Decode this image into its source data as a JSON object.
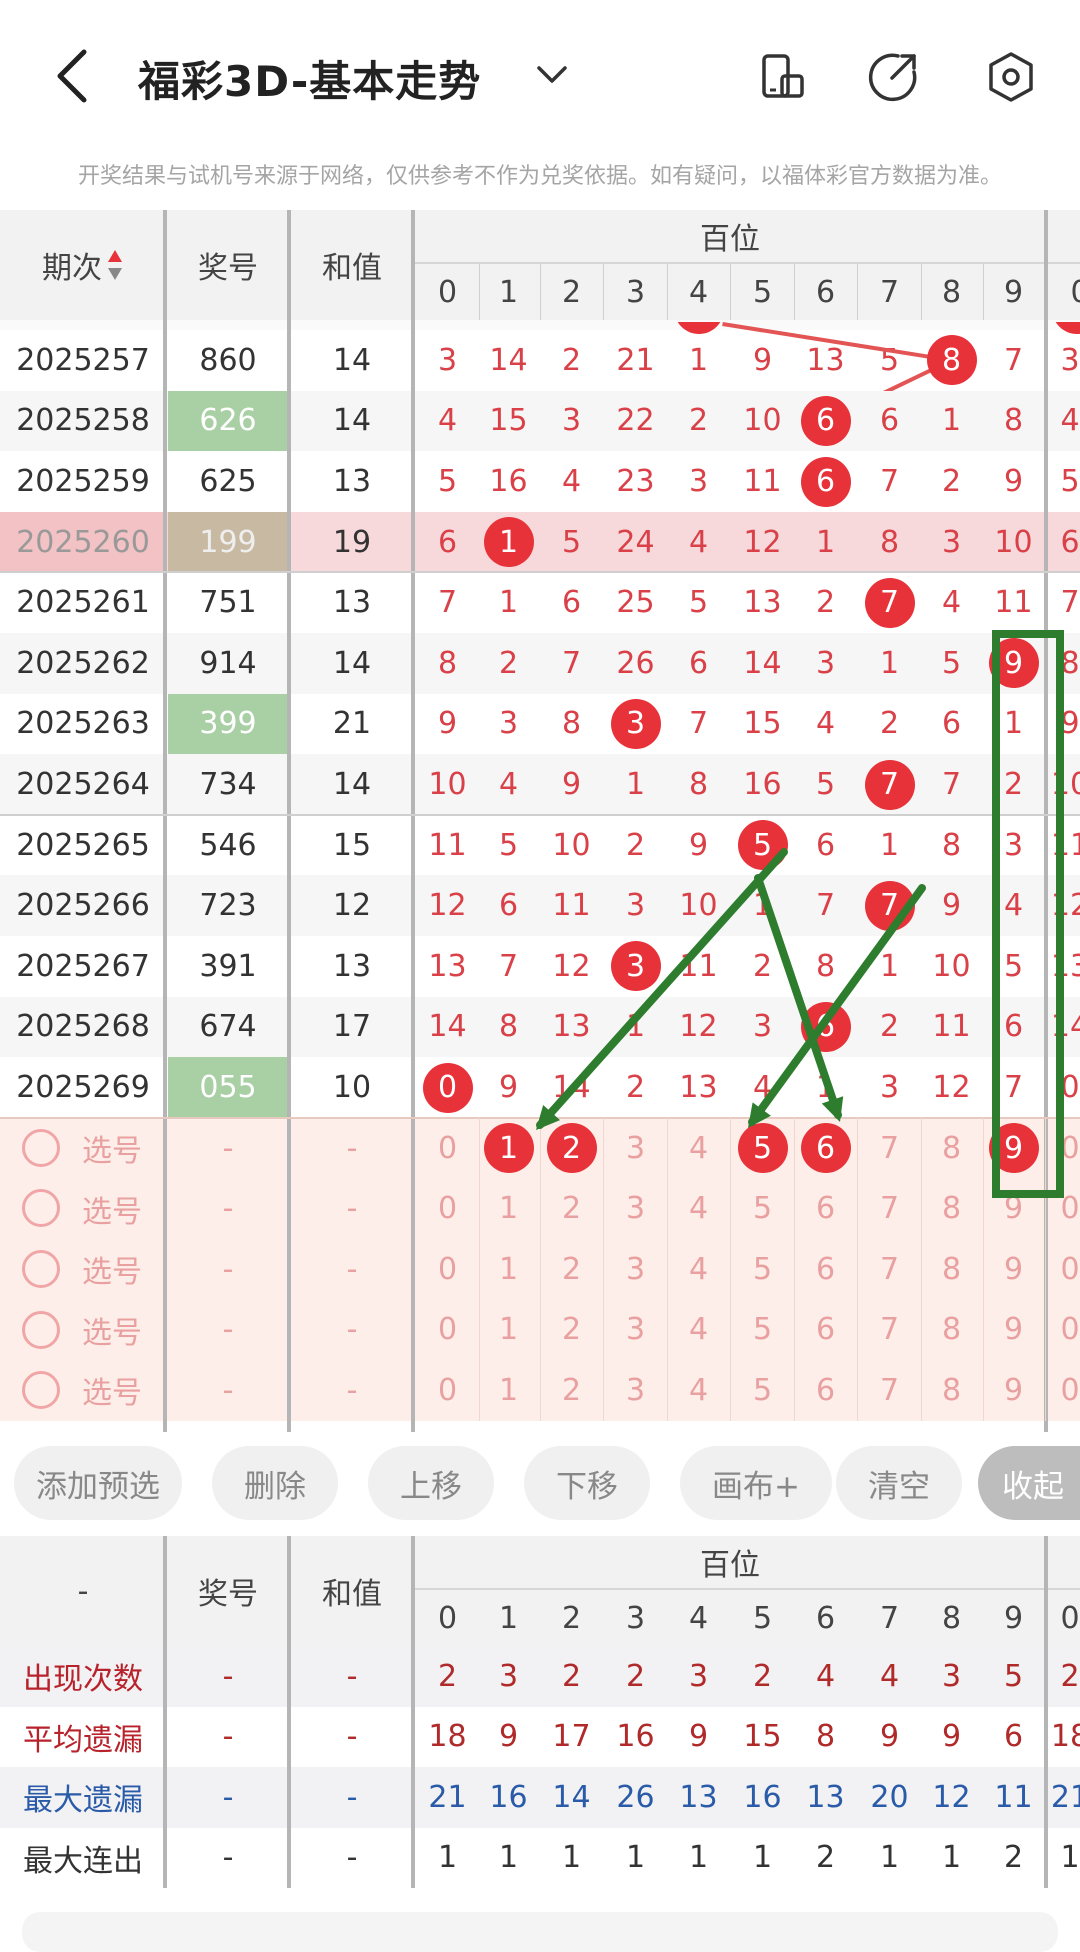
{
  "header": {
    "title": "福彩3D-基本走势",
    "disclaimer": "开奖结果与试机号来源于网络，仅供参考不作为兑奖依据。如有疑问，以福体彩官方数据为准。"
  },
  "table": {
    "col_period": "期次",
    "col_number": "奖号",
    "col_sum": "和值",
    "group_label": "百位",
    "digits": [
      "0",
      "1",
      "2",
      "3",
      "4",
      "5",
      "6",
      "7",
      "8",
      "9"
    ],
    "rows": [
      {
        "period": "2025257",
        "number": "860",
        "sum": "14",
        "omit": [
          "3",
          "14",
          "2",
          "21",
          "1",
          "9",
          "13",
          "5",
          "8",
          "7"
        ],
        "hit": 8,
        "highlight": false,
        "selected": false
      },
      {
        "period": "2025258",
        "number": "626",
        "sum": "14",
        "omit": [
          "4",
          "15",
          "3",
          "22",
          "2",
          "10",
          "6",
          "6",
          "1",
          "8"
        ],
        "hit": 6,
        "highlight": true,
        "selected": false
      },
      {
        "period": "2025259",
        "number": "625",
        "sum": "13",
        "omit": [
          "5",
          "16",
          "4",
          "23",
          "3",
          "11",
          "6",
          "7",
          "2",
          "9"
        ],
        "hit": 6,
        "highlight": false,
        "selected": false
      },
      {
        "period": "2025260",
        "number": "199",
        "sum": "19",
        "omit": [
          "6",
          "1",
          "5",
          "24",
          "4",
          "12",
          "1",
          "8",
          "3",
          "10"
        ],
        "hit": 1,
        "highlight": true,
        "selected": true
      },
      {
        "period": "2025261",
        "number": "751",
        "sum": "13",
        "omit": [
          "7",
          "1",
          "6",
          "25",
          "5",
          "13",
          "2",
          "7",
          "4",
          "11"
        ],
        "hit": 7,
        "highlight": false,
        "selected": false
      },
      {
        "period": "2025262",
        "number": "914",
        "sum": "14",
        "omit": [
          "8",
          "2",
          "7",
          "26",
          "6",
          "14",
          "3",
          "1",
          "5",
          "9"
        ],
        "hit": 9,
        "highlight": false,
        "selected": false
      },
      {
        "period": "2025263",
        "number": "399",
        "sum": "21",
        "omit": [
          "9",
          "3",
          "8",
          "3",
          "7",
          "15",
          "4",
          "2",
          "6",
          "1"
        ],
        "hit": 3,
        "highlight": true,
        "selected": false
      },
      {
        "period": "2025264",
        "number": "734",
        "sum": "14",
        "omit": [
          "10",
          "4",
          "9",
          "1",
          "8",
          "16",
          "5",
          "7",
          "7",
          "2"
        ],
        "hit": 7,
        "highlight": false,
        "selected": false
      },
      {
        "period": "2025265",
        "number": "546",
        "sum": "15",
        "omit": [
          "11",
          "5",
          "10",
          "2",
          "9",
          "5",
          "6",
          "1",
          "8",
          "3"
        ],
        "hit": 5,
        "highlight": false,
        "selected": false
      },
      {
        "period": "2025266",
        "number": "723",
        "sum": "12",
        "omit": [
          "12",
          "6",
          "11",
          "3",
          "10",
          "1",
          "7",
          "7",
          "9",
          "4"
        ],
        "hit": 7,
        "highlight": false,
        "selected": false
      },
      {
        "period": "2025267",
        "number": "391",
        "sum": "13",
        "omit": [
          "13",
          "7",
          "12",
          "3",
          "11",
          "2",
          "8",
          "1",
          "10",
          "5"
        ],
        "hit": 3,
        "highlight": false,
        "selected": false
      },
      {
        "period": "2025268",
        "number": "674",
        "sum": "17",
        "omit": [
          "14",
          "8",
          "13",
          "1",
          "12",
          "3",
          "6",
          "2",
          "11",
          "6"
        ],
        "hit": 6,
        "highlight": false,
        "selected": false
      },
      {
        "period": "2025269",
        "number": "055",
        "sum": "10",
        "omit": [
          "0",
          "9",
          "14",
          "2",
          "13",
          "4",
          "1",
          "3",
          "12",
          "7"
        ],
        "hit": 0,
        "highlight": true,
        "selected": false
      }
    ],
    "pick_label": "选号",
    "pick_dash": "-",
    "pick_selected": [
      1,
      2,
      5,
      6,
      9
    ]
  },
  "buttons": [
    "添加预选",
    "删除",
    "上移",
    "下移",
    "画布+",
    "清空",
    "收起"
  ],
  "stats": {
    "corner": "-",
    "col_number": "奖号",
    "col_sum": "和值",
    "group_label": "百位",
    "rows": [
      {
        "label": "出现次数",
        "color": "red",
        "values": [
          "2",
          "3",
          "2",
          "2",
          "3",
          "2",
          "4",
          "4",
          "3",
          "5"
        ]
      },
      {
        "label": "平均遗漏",
        "color": "red",
        "values": [
          "18",
          "9",
          "17",
          "16",
          "9",
          "15",
          "8",
          "9",
          "9",
          "6"
        ]
      },
      {
        "label": "最大遗漏",
        "color": "blue",
        "values": [
          "21",
          "16",
          "14",
          "26",
          "13",
          "16",
          "13",
          "20",
          "12",
          "11"
        ]
      },
      {
        "label": "最大连出",
        "color": "plain",
        "values": [
          "1",
          "1",
          "1",
          "1",
          "1",
          "1",
          "2",
          "1",
          "1",
          "2"
        ]
      }
    ]
  },
  "colors": {
    "accent": "#e8323a",
    "highlight_green": "#a9cfa4",
    "selected_row": "#f7d9db",
    "pick_bg": "#fdeee9",
    "annotation": "#2e7d2e"
  }
}
